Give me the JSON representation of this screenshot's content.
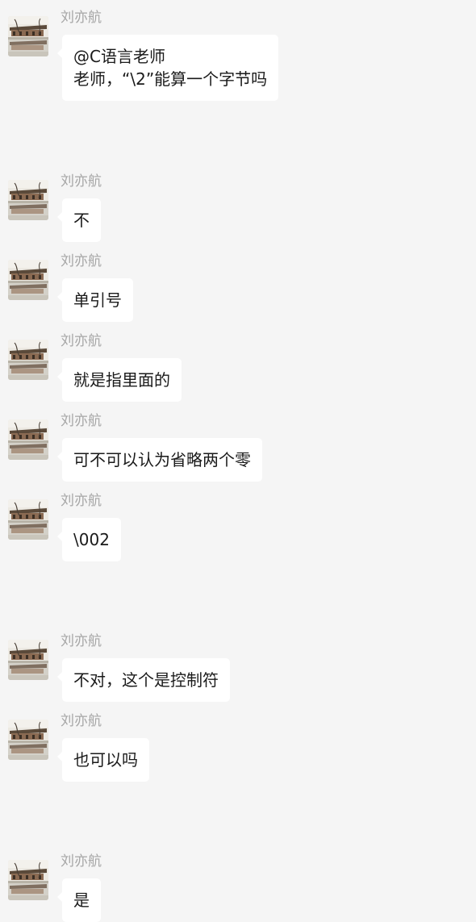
{
  "messages": [
    {
      "sender": "刘亦航",
      "lines": [
        "@C语言老师",
        "老师，“\\2”能算一个字节吗"
      ]
    },
    {
      "sender": "刘亦航",
      "lines": [
        "不"
      ]
    },
    {
      "sender": "刘亦航",
      "lines": [
        "单引号"
      ]
    },
    {
      "sender": "刘亦航",
      "lines": [
        "就是指里面的"
      ]
    },
    {
      "sender": "刘亦航",
      "lines": [
        "可不可以认为省略两个零"
      ]
    },
    {
      "sender": "刘亦航",
      "lines": [
        "\\002"
      ]
    },
    {
      "sender": "刘亦航",
      "lines": [
        "不对，这个是控制符"
      ]
    },
    {
      "sender": "刘亦航",
      "lines": [
        "也可以吗"
      ]
    },
    {
      "sender": "刘亦航",
      "lines": [
        "是"
      ]
    }
  ],
  "avatar_icon": "avatar-building-photo-icon",
  "colors": {
    "background": "#f5f5f5",
    "bubble": "#ffffff",
    "sender_name": "#a6a6a6",
    "message_text": "#1a1a1a"
  }
}
